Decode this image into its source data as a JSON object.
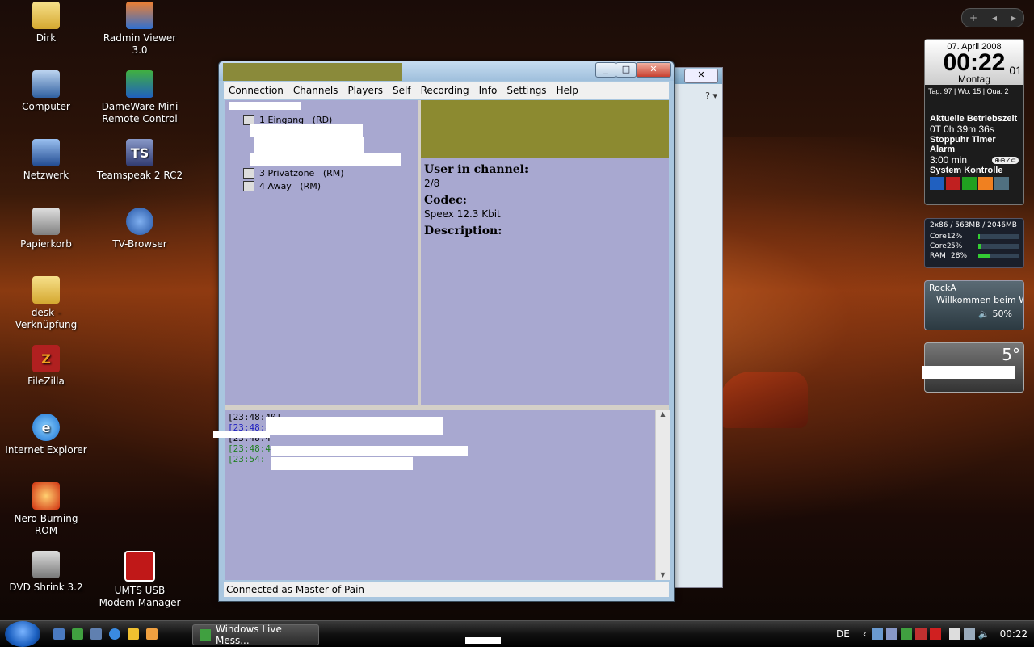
{
  "desktop": {
    "icons": [
      {
        "label": "Dirk",
        "icon": "folder-icon"
      },
      {
        "label": "Radmin Viewer 3.0",
        "icon": "radmin-icon"
      },
      {
        "label": "Computer",
        "icon": "computer-icon"
      },
      {
        "label": "DameWare Mini Remote Control",
        "icon": "dameware-icon"
      },
      {
        "label": "Netzwerk",
        "icon": "network-icon"
      },
      {
        "label": "Teamspeak 2 RC2",
        "icon": "teamspeak-icon"
      },
      {
        "label": "Papierkorb",
        "icon": "recycle-bin-icon"
      },
      {
        "label": "TV-Browser",
        "icon": "tv-browser-icon"
      },
      {
        "label": "desk - Verknüpfung",
        "icon": "folder-shortcut-icon"
      },
      {
        "label": "FileZilla",
        "icon": "filezilla-icon"
      },
      {
        "label": "Internet Explorer",
        "icon": "internet-explorer-icon"
      },
      {
        "label": "Nero Burning ROM",
        "icon": "nero-icon"
      },
      {
        "label": "DVD Shrink 3.2",
        "icon": "dvd-shrink-icon"
      },
      {
        "label": "UMTS USB Modem Manager",
        "icon": "umts-modem-icon"
      }
    ]
  },
  "gadgets": {
    "clock": {
      "date": "07. April 2008",
      "time": "00:22",
      "seconds": "01",
      "weekday": "Montag",
      "stats": "Tag: 97 | Wo: 15 | Qua: 2",
      "uptime_label": "Aktuelle Betriebszeit",
      "uptime_value": "0T 0h 39m 36s",
      "timer_label": "Stoppuhr Timer Alarm",
      "timer_value": "3:00 min",
      "control_label": "System Kontrolle"
    },
    "cpu": {
      "header": "2x86 / 563MB / 2046MB",
      "rows": [
        {
          "name": "Core1",
          "value": "2%",
          "level": 0.02
        },
        {
          "name": "Core2",
          "value": "5%",
          "level": 0.05
        },
        {
          "name": "RAM",
          "value": "28%",
          "level": 0.28
        }
      ]
    },
    "radio": {
      "station": "RockA",
      "text": "Willkommen beim W",
      "volume": "50%"
    },
    "weather": {
      "temp": "5°"
    }
  },
  "teamspeak": {
    "menu": [
      "Connection",
      "Channels",
      "Players",
      "Self",
      "Recording",
      "Info",
      "Settings",
      "Help"
    ],
    "tree": {
      "channels": [
        {
          "name": "1 Eingang",
          "flags": "(RD)"
        },
        {
          "name": "3 Privatzone",
          "flags": "(RM)"
        },
        {
          "name": "4 Away",
          "flags": "(RM)"
        }
      ]
    },
    "info": {
      "users_label": "User in channel:",
      "users_value": "2/8",
      "codec_label": "Codec:",
      "codec_value": "Speex 12.3 Kbit",
      "description_label": "Description:"
    },
    "chat": {
      "lines": [
        {
          "time": "[23:48:40]",
          "color": "#000000"
        },
        {
          "time": "[23:48:40]",
          "color": "#2020c0"
        },
        {
          "time": "[23:48:4",
          "color": "#000000"
        },
        {
          "time": "[23:48:4",
          "color": "#208020"
        },
        {
          "time": "[23:54:",
          "color": "#208020"
        }
      ]
    },
    "status": "Connected as Master of Pain"
  },
  "bgwindow": {
    "help": "? ▾"
  },
  "taskbar": {
    "task_label": "Windows Live Mess...",
    "language": "DE",
    "clock": "00:22"
  }
}
